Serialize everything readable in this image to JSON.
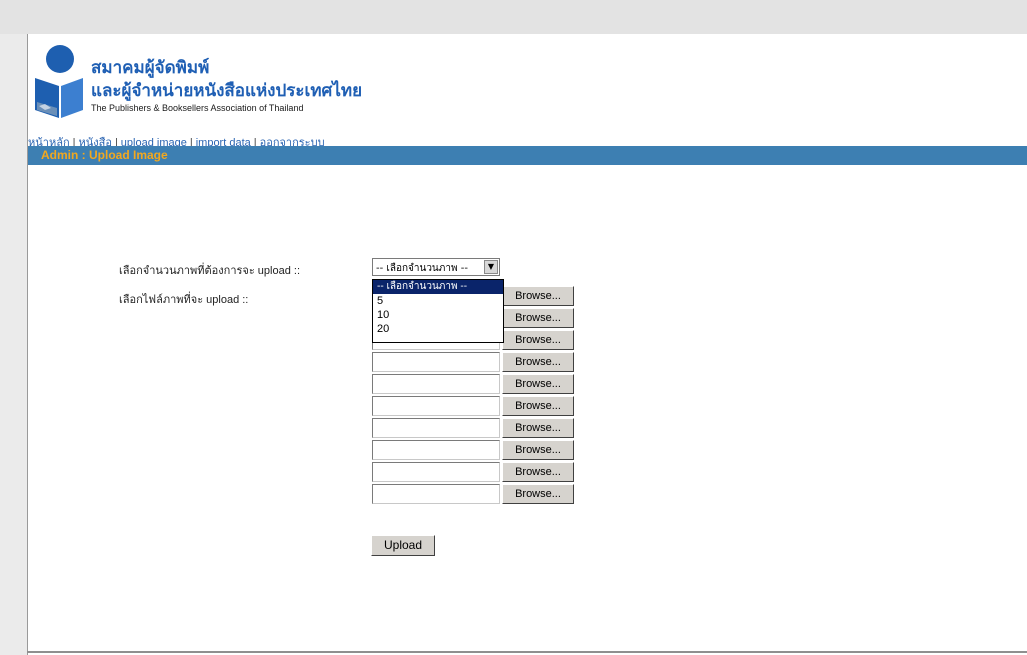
{
  "header": {
    "org_name_thai_line1": "สมาคมผู้จัดพิมพ์",
    "org_name_thai_line2": "และผู้จำหน่ายหนังสือแห่งประเทศไทย",
    "org_name_english": "The Publishers & Booksellers Association of Thailand",
    "logo_icon": "book-reader-logo-icon"
  },
  "nav": {
    "items": [
      "หน้าหลัก",
      "หนังสือ",
      "upload image",
      "import data",
      "ออกจากระบบ"
    ],
    "separator": "|"
  },
  "page_title": "Admin : Upload Image",
  "form": {
    "count_label": "เลือกจำนวนภาพที่ต้องการจะ upload ::",
    "file_label": "เลือกไฟล์ภาพที่จะ upload ::",
    "count_select_value": "-- เลือกจำนวนภาพ --",
    "count_options": [
      "-- เลือกจำนวนภาพ --",
      "5",
      "10",
      "20"
    ],
    "browse_label": "Browse...",
    "upload_label": "Upload"
  },
  "colors": {
    "title_bar": "#3d7fb2",
    "title_text": "#f2a81f",
    "brand_blue": "#1f5fb4",
    "selection": "#0a246a"
  }
}
